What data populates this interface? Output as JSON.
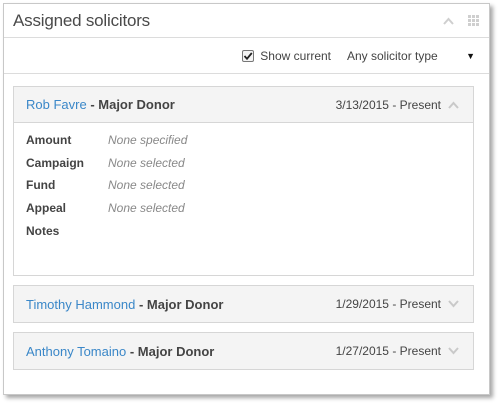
{
  "panel": {
    "title": "Assigned solicitors"
  },
  "toolbar": {
    "show_current_label": "Show current",
    "show_current_checked": true,
    "type_filter_value": "Any solicitor type"
  },
  "solicitors": [
    {
      "name": "Rob Favre",
      "separator": " - ",
      "type": "Major Donor",
      "dates": "3/13/2015 - Present",
      "expanded": true,
      "details": [
        {
          "label": "Amount",
          "value": "None specified"
        },
        {
          "label": "Campaign",
          "value": "None selected"
        },
        {
          "label": "Fund",
          "value": "None selected"
        },
        {
          "label": "Appeal",
          "value": "None selected"
        },
        {
          "label": "Notes",
          "value": ""
        }
      ]
    },
    {
      "name": "Timothy Hammond",
      "separator": " - ",
      "type": "Major Donor",
      "dates": "1/29/2015 - Present",
      "expanded": false
    },
    {
      "name": "Anthony Tomaino",
      "separator": " - ",
      "type": "Major Donor",
      "dates": "1/27/2015 - Present",
      "expanded": false
    }
  ],
  "colors": {
    "link": "#3a87c8",
    "card_header_bg": "#f4f4f4",
    "border": "#d6d6d6",
    "muted_text": "#888888"
  },
  "icons": {
    "collapse": "chevron-up-icon",
    "layout": "grid-icon",
    "expand": "chevron-down-icon"
  }
}
